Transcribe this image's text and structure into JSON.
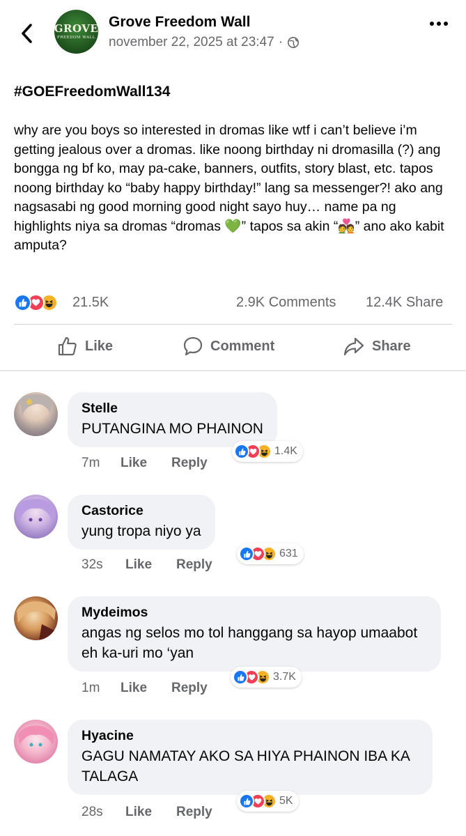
{
  "header": {
    "page_name": "Grove Freedom Wall",
    "timestamp": "november 22, 2025 at 23:47",
    "separator": "·",
    "logo_main": "GROVE",
    "logo_sub": "FREEDOM WALL"
  },
  "post": {
    "hashtag": "#GOEFreedomWall134",
    "body_part1": "why are you boys so interested in dromas like wtf i can’t believe i’m getting jealous over a dromas. like noong birthday ni dromasilla (?) ang bongga ng bf ko, may pa-cake, banners, outfits, story blast, etc. tapos noong birthday ko “baby happy birthday!” lang sa messenger?! ako ang nagsasabi ng good morning good night sayo huy… name pa ng highlights niya sa dromas “dromas ",
    "emoji_heart": "💚",
    "body_part2": "” tapos sa akin “",
    "emoji_couple": "💑",
    "body_part3": "” ano ako kabit amputa?"
  },
  "stats": {
    "reactions": "21.5K",
    "comments": "2.9K Comments",
    "shares": "12.4K Share"
  },
  "actions": {
    "like": "Like",
    "comment": "Comment",
    "share": "Share"
  },
  "comments": [
    {
      "name": "Stelle",
      "text": "PUTANGINA MO PHAINON",
      "time": "7m",
      "like": "Like",
      "reply": "Reply",
      "reactions": "1.4K"
    },
    {
      "name": "Castorice",
      "text": "yung tropa niyo ya",
      "time": "32s",
      "like": "Like",
      "reply": "Reply",
      "reactions": "631"
    },
    {
      "name": "Mydeimos",
      "text": "angas ng selos mo tol hanggang sa hayop umaabot eh ka-uri mo ‘yan",
      "time": "1m",
      "like": "Like",
      "reply": "Reply",
      "reactions": "3.7K"
    },
    {
      "name": "Hyacine",
      "text": "GAGU NAMATAY AKO SA HIYA PHAINON IBA KA TALAGA",
      "time": "28s",
      "like": "Like",
      "reply": "Reply",
      "reactions": "5K"
    }
  ],
  "colors": {
    "like_blue": "#1877f2",
    "love_red": "#f33e58",
    "haha_yellow": "#f7b125",
    "secondary_text": "#65676b",
    "bubble_bg": "#f0f2f5"
  }
}
